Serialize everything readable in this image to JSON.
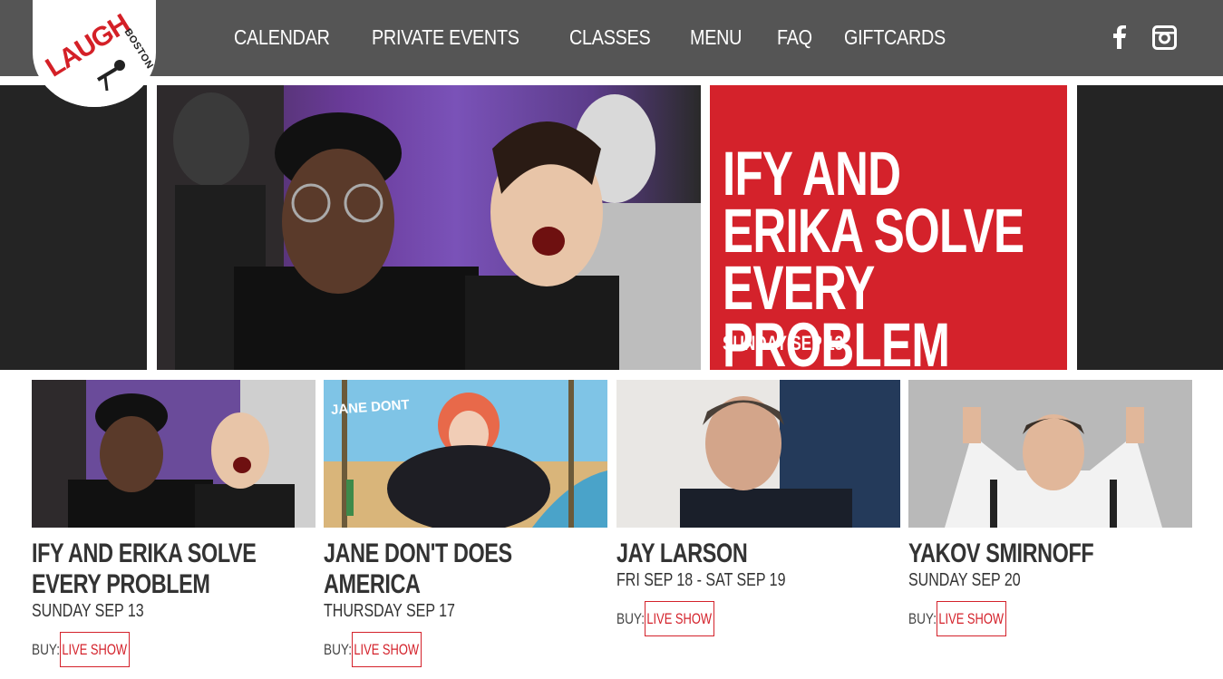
{
  "header": {
    "logo_text": "LAUGH",
    "logo_subtext": "BOSTON",
    "nav": [
      "CALENDAR",
      "PRIVATE EVENTS",
      "CLASSES",
      "MENU",
      "FAQ",
      "GIFTCARDS"
    ],
    "social": [
      "facebook-icon",
      "instagram-icon"
    ]
  },
  "hero": {
    "title": "IFY AND ERIKA SOLVE EVERY PROBLEM",
    "date": "SUNDAY SEP 13",
    "accent_color": "#d4222b"
  },
  "events": [
    {
      "title": "IFY AND ERIKA SOLVE EVERY PROBLEM",
      "date": "SUNDAY SEP 13",
      "buy_label": "BUY:",
      "button": "LIVE SHOW"
    },
    {
      "title": "JANE DON'T DOES AMERICA",
      "date": "THURSDAY SEP 17",
      "buy_label": "BUY:",
      "button": "LIVE SHOW",
      "thumb_text": "JANE DONT"
    },
    {
      "title": "JAY LARSON",
      "date": "FRI SEP 18 - SAT SEP 19",
      "buy_label": "BUY:",
      "button": "LIVE SHOW"
    },
    {
      "title": "YAKOV SMIRNOFF",
      "date": "SUNDAY SEP 20",
      "buy_label": "BUY:",
      "button": "LIVE SHOW"
    }
  ]
}
